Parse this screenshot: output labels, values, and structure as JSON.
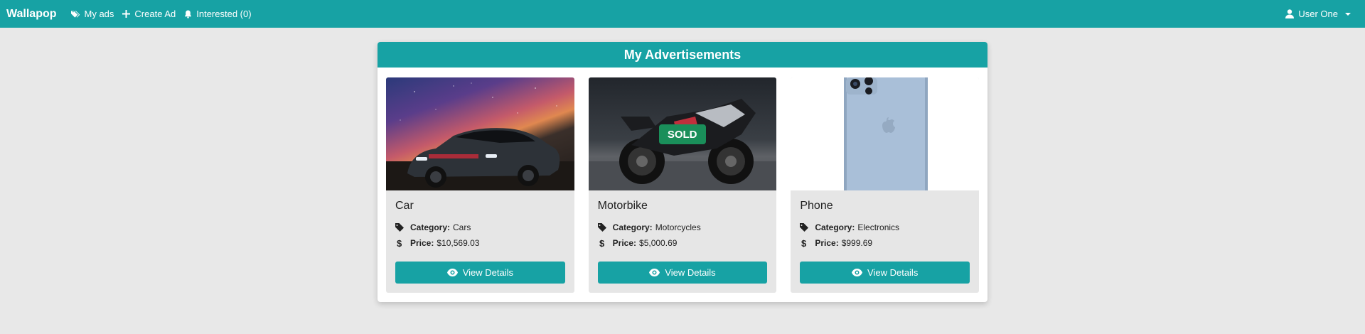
{
  "nav": {
    "brand": "Wallapop",
    "links": [
      {
        "label": "My ads",
        "icon": "tags-icon"
      },
      {
        "label": "Create Ad",
        "icon": "plus-icon"
      },
      {
        "label": "Interested (0)",
        "icon": "bell-icon"
      }
    ],
    "user": "User One"
  },
  "panel": {
    "title": "My Advertisements"
  },
  "cards": [
    {
      "title": "Car",
      "category_label": "Category:",
      "category": "Cars",
      "price_label": "Price:",
      "price": "$10,569.03",
      "button": "View Details",
      "sold": ""
    },
    {
      "title": "Motorbike",
      "category_label": "Category:",
      "category": "Motorcycles",
      "price_label": "Price:",
      "price": "$5,000.69",
      "button": "View Details",
      "sold": "SOLD"
    },
    {
      "title": "Phone",
      "category_label": "Category:",
      "category": "Electronics",
      "price_label": "Price:",
      "price": "$999.69",
      "button": "View Details",
      "sold": ""
    }
  ],
  "colors": {
    "primary": "#17a2a4",
    "sold": "#1a8f5a",
    "background": "#e8e8e8"
  }
}
